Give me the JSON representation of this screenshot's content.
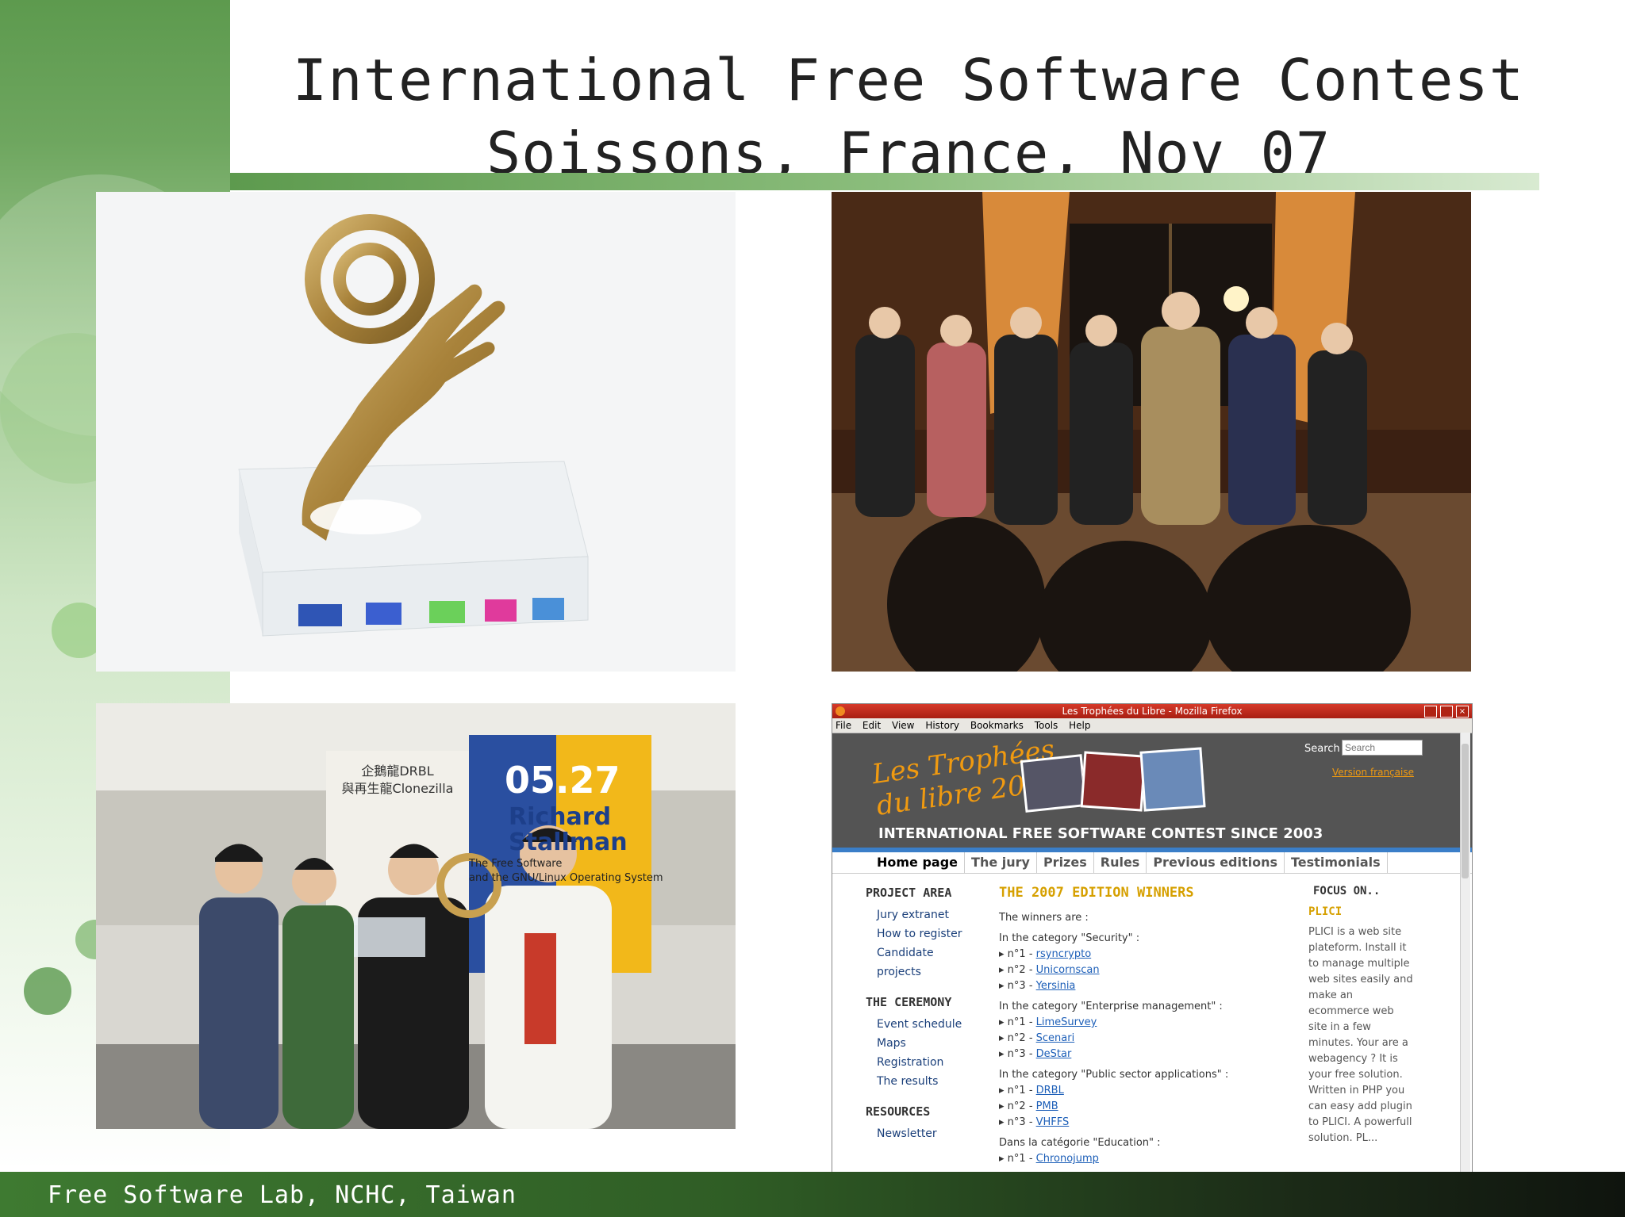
{
  "slide": {
    "title_line1": "International Free Software Contest",
    "title_line2": "Soissons, France, Nov 07",
    "footer": "Free Software Lab, NCHC, Taiwan"
  },
  "browser": {
    "window_title": "Les Trophées du Libre - Mozilla Firefox",
    "menu": [
      "File",
      "Edit",
      "View",
      "History",
      "Bookmarks",
      "Tools",
      "Help"
    ],
    "logo_line1": "Les Trophées",
    "logo_line2": "du libre 2007",
    "search_label": "Search",
    "search_placeholder": "Search",
    "version_link": "Version française",
    "banner_tagline": "INTERNATIONAL FREE SOFTWARE CONTEST SINCE 2003",
    "nav": [
      "Home page",
      "The jury",
      "Prizes",
      "Rules",
      "Previous editions",
      "Testimonials"
    ],
    "left_sections": [
      {
        "heading": "PROJECT AREA",
        "links": [
          "Jury extranet",
          "How to register",
          "Candidate projects"
        ]
      },
      {
        "heading": "THE CEREMONY",
        "links": [
          "Event schedule",
          "Maps",
          "Registration",
          "The results"
        ]
      },
      {
        "heading": "RESOURCES",
        "links": [
          "Newsletter"
        ]
      }
    ],
    "main_heading": "THE 2007 EDITION WINNERS",
    "intro": "The winners are :",
    "categories": [
      {
        "title": "In the category \"Security\" :",
        "entries": [
          {
            "rank": "n°1 - ",
            "name": "rsyncrypto"
          },
          {
            "rank": "n°2 - ",
            "name": "Unicornscan"
          },
          {
            "rank": "n°3 - ",
            "name": "Yersinia"
          }
        ]
      },
      {
        "title": "In the category \"Enterprise management\" :",
        "entries": [
          {
            "rank": "n°1 - ",
            "name": "LimeSurvey"
          },
          {
            "rank": "n°2 - ",
            "name": "Scenari"
          },
          {
            "rank": "n°3 - ",
            "name": "DeStar"
          }
        ]
      },
      {
        "title": "In the category \"Public sector applications\" :",
        "entries": [
          {
            "rank": "n°1 - ",
            "name": "DRBL"
          },
          {
            "rank": "n°2 - ",
            "name": "PMB"
          },
          {
            "rank": "n°3 - ",
            "name": "VHFFS"
          }
        ]
      },
      {
        "title": "Dans la catégorie \"Education\" :",
        "entries": [
          {
            "rank": "n°1 - ",
            "name": "Chronojump"
          }
        ]
      }
    ],
    "focus_heading": "FOCUS ON..",
    "focus_title": "PLICI",
    "focus_text": "PLICI is a web site plateform. Install it to manage multiple web sites easily and make an ecommerce web site in a few minutes. Your are a webagency ? It is your free solution. Written in PHP you can easy add plugin to PLICI. A powerfull solution. PL..."
  },
  "photos": {
    "team_banner_line1": "企鵝龍DRBL",
    "team_banner_line2": "與再生龍Clonezilla",
    "team_poster": "05.27",
    "team_poster_sub": "Richard Stallman",
    "team_poster_text1": "The Free Software",
    "team_poster_text2": "and the GNU/Linux Operating System"
  },
  "colors": {
    "green_dark": "#3e7a31",
    "green_mid": "#6ea65f",
    "gold": "#b8923a",
    "firefox_red": "#c0281a",
    "link_blue": "#1d5fb8",
    "heading_gold": "#d6a000"
  }
}
